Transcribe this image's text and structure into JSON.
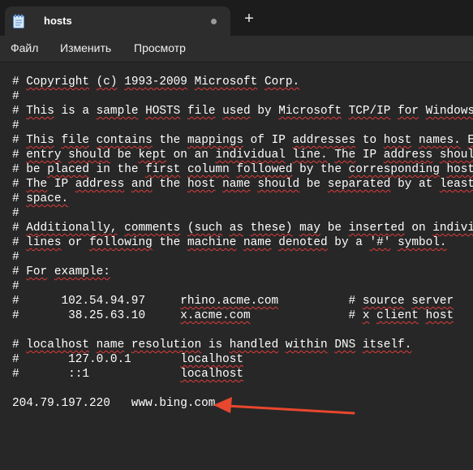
{
  "tab": {
    "title": "hosts",
    "new_tab_symbol": "+"
  },
  "menu": [
    "Файл",
    "Изменить",
    "Просмотр"
  ],
  "lines": [
    "# Copyright (c) 1993-2009 Microsoft Corp.",
    "#",
    "# This is a sample HOSTS file used by Microsoft TCP/IP for Windows.",
    "#",
    "# This file contains the mappings of IP addresses to host names. Each",
    "# entry should be kept on an individual line. The IP address should",
    "# be placed in the first column followed by the corresponding host name.",
    "# The IP address and the host name should be separated by at least one",
    "# space.",
    "#",
    "# Additionally, comments (such as these) may be inserted on individual",
    "# lines or following the machine name denoted by a '#' symbol.",
    "#",
    "# For example:",
    "#",
    "#      102.54.94.97     rhino.acme.com          # source server",
    "#       38.25.63.10     x.acme.com              # x client host",
    "",
    "# localhost name resolution is handled within DNS itself.",
    "#       127.0.0.1       localhost",
    "#       ::1             localhost",
    "",
    "204.79.197.220   www.bing.com"
  ],
  "colors": {
    "background": "#272727",
    "titlebar": "#1c1c1c",
    "menubar": "#2d2d2d",
    "text": "#ffffff",
    "squiggle": "#e03a3a",
    "arrow": "#e8472f"
  },
  "icons": [
    "notepad-icon",
    "unsaved-dot-icon",
    "plus-icon",
    "red-arrow-annotation"
  ]
}
